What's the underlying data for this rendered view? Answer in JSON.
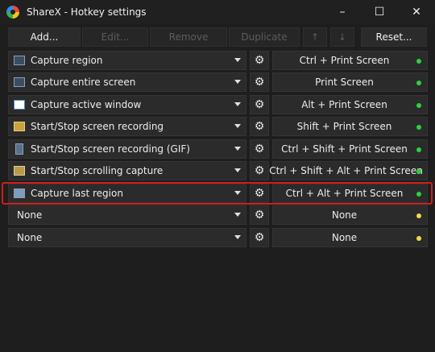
{
  "window": {
    "title": "ShareX - Hotkey settings",
    "minimize": "–",
    "maximize": "☐",
    "close": "✕"
  },
  "toolbar": {
    "add": "Add...",
    "edit": "Edit...",
    "remove": "Remove",
    "duplicate": "Duplicate",
    "up": "↑",
    "down": "↓",
    "reset": "Reset..."
  },
  "rows": [
    {
      "task": "Capture region",
      "icon": "capture-region-icon",
      "hotkey": "Ctrl + Print Screen",
      "status": "green"
    },
    {
      "task": "Capture entire screen",
      "icon": "capture-screen-icon",
      "hotkey": "Print Screen",
      "status": "green"
    },
    {
      "task": "Capture active window",
      "icon": "active-window-icon",
      "hotkey": "Alt + Print Screen",
      "status": "green"
    },
    {
      "task": "Start/Stop screen recording",
      "icon": "screen-recording-icon",
      "hotkey": "Shift + Print Screen",
      "status": "green"
    },
    {
      "task": "Start/Stop screen recording (GIF)",
      "icon": "gif-recording-icon",
      "hotkey": "Ctrl + Shift + Print Screen",
      "status": "green"
    },
    {
      "task": "Start/Stop scrolling capture",
      "icon": "scrolling-capture-icon",
      "hotkey": "Ctrl + Shift + Alt + Print Screen",
      "status": "green"
    },
    {
      "task": "Capture last region",
      "icon": "last-region-icon",
      "hotkey": "Ctrl + Alt + Print Screen",
      "status": "green"
    },
    {
      "task": "None",
      "icon": "",
      "hotkey": "None",
      "status": "yellow"
    },
    {
      "task": "None",
      "icon": "",
      "hotkey": "None",
      "status": "yellow"
    }
  ],
  "colors": {
    "status_green": "#2bd13b",
    "status_yellow": "#f0d94a",
    "highlight": "#d21e1e"
  }
}
